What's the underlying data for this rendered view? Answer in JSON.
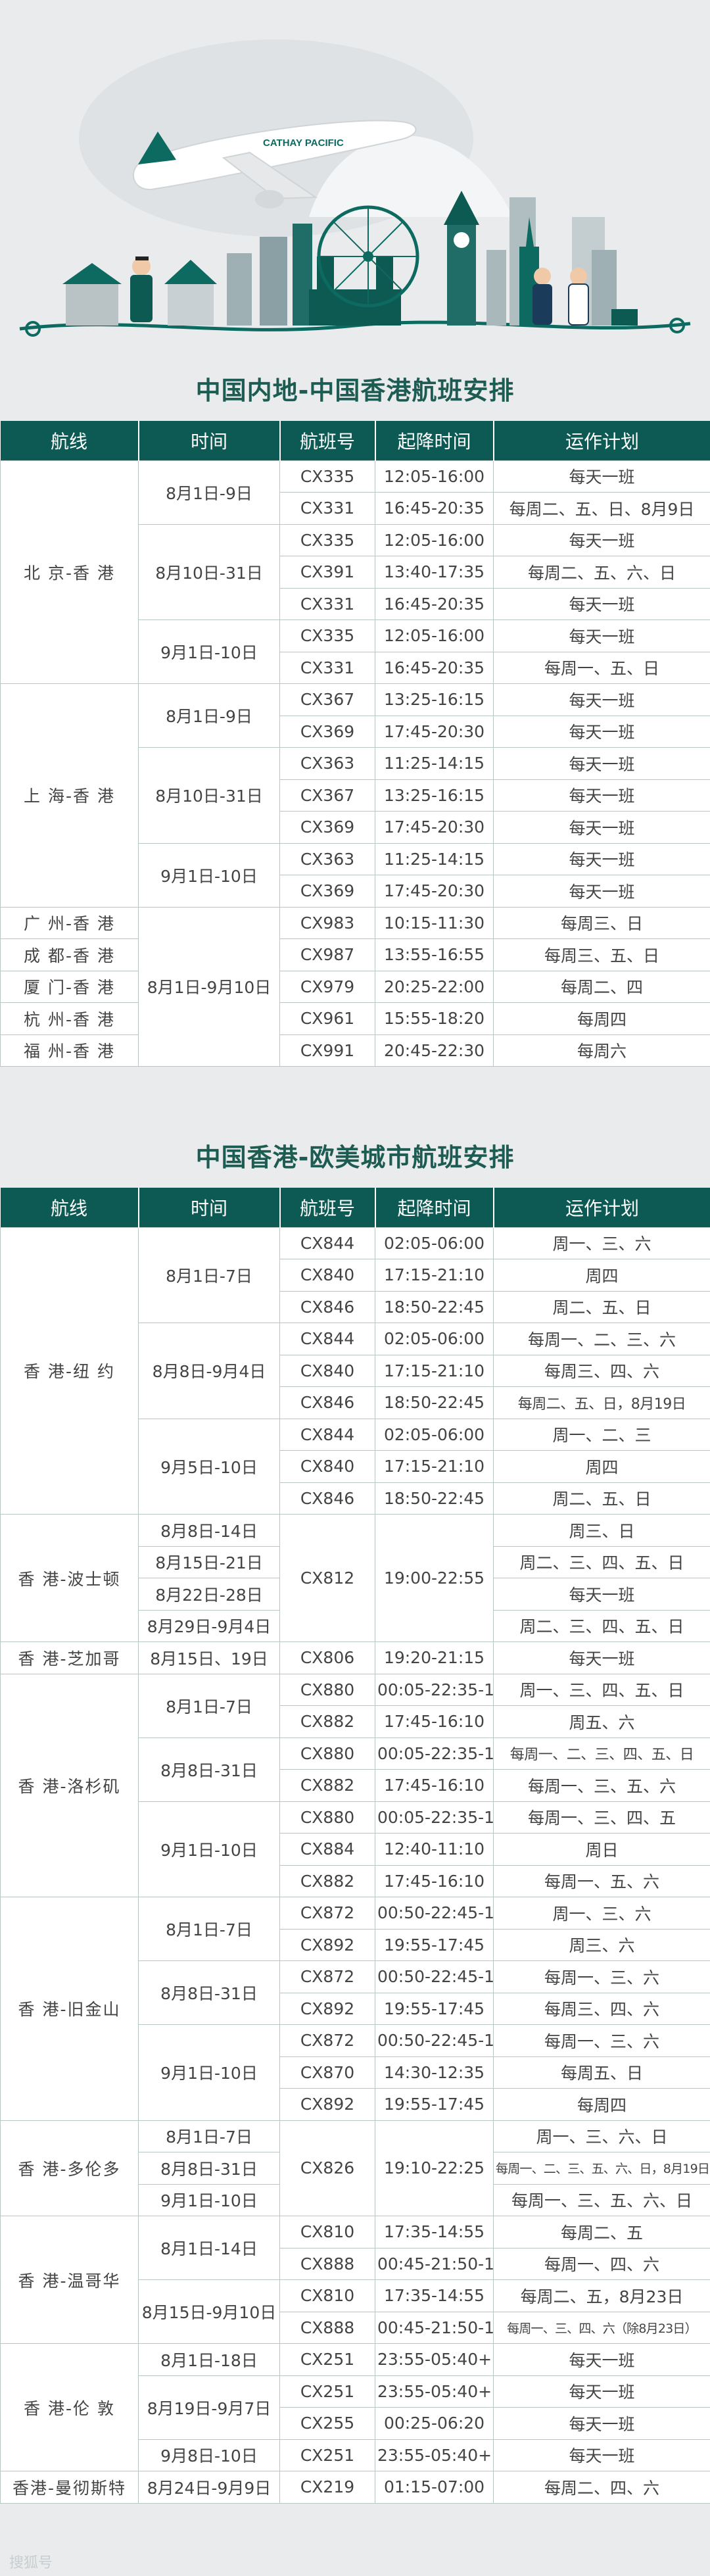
{
  "watermark": "搜狐号",
  "brand_text": "CATHAY PACIFIC",
  "colors": {
    "header_bg": "#0c5a53",
    "title": "#1d5c52",
    "border": "#b9c6c3",
    "page_bg": "#e9ebec"
  },
  "headers": [
    "航线",
    "时间",
    "航班号",
    "起降时间",
    "运作计划"
  ],
  "sections": [
    {
      "title": "中国内地-中国香港航班安排",
      "routes": [
        {
          "name": "北 京-香 港",
          "periods": [
            {
              "date": "8月1日-9日",
              "flights": [
                {
                  "no": "CX335",
                  "time": "12:05-16:00",
                  "plan": "每天一班"
                },
                {
                  "no": "CX331",
                  "time": "16:45-20:35",
                  "plan": "每周二、五、日、8月9日"
                }
              ]
            },
            {
              "date": "8月10日-31日",
              "flights": [
                {
                  "no": "CX335",
                  "time": "12:05-16:00",
                  "plan": "每天一班"
                },
                {
                  "no": "CX391",
                  "time": "13:40-17:35",
                  "plan": "每周二、五、六、日"
                },
                {
                  "no": "CX331",
                  "time": "16:45-20:35",
                  "plan": "每天一班"
                }
              ]
            },
            {
              "date": "9月1日-10日",
              "flights": [
                {
                  "no": "CX335",
                  "time": "12:05-16:00",
                  "plan": "每天一班"
                },
                {
                  "no": "CX331",
                  "time": "16:45-20:35",
                  "plan": "每周一、五、日"
                }
              ]
            }
          ]
        },
        {
          "name": "上 海-香 港",
          "periods": [
            {
              "date": "8月1日-9日",
              "flights": [
                {
                  "no": "CX367",
                  "time": "13:25-16:15",
                  "plan": "每天一班"
                },
                {
                  "no": "CX369",
                  "time": "17:45-20:30",
                  "plan": "每天一班"
                }
              ]
            },
            {
              "date": "8月10日-31日",
              "flights": [
                {
                  "no": "CX363",
                  "time": "11:25-14:15",
                  "plan": "每天一班"
                },
                {
                  "no": "CX367",
                  "time": "13:25-16:15",
                  "plan": "每天一班"
                },
                {
                  "no": "CX369",
                  "time": "17:45-20:30",
                  "plan": "每天一班"
                }
              ]
            },
            {
              "date": "9月1日-10日",
              "flights": [
                {
                  "no": "CX363",
                  "time": "11:25-14:15",
                  "plan": "每天一班"
                },
                {
                  "no": "CX369",
                  "time": "17:45-20:30",
                  "plan": "每天一班"
                }
              ]
            }
          ]
        }
      ],
      "shared_block": {
        "date": "8月1日-9月10日",
        "rows": [
          {
            "route": "广 州-香 港",
            "no": "CX983",
            "time": "10:15-11:30",
            "plan": "每周三、日"
          },
          {
            "route": "成 都-香 港",
            "no": "CX987",
            "time": "13:55-16:55",
            "plan": "每周三、五、日"
          },
          {
            "route": "厦 门-香 港",
            "no": "CX979",
            "time": "20:25-22:00",
            "plan": "每周二、四"
          },
          {
            "route": "杭 州-香 港",
            "no": "CX961",
            "time": "15:55-18:20",
            "plan": "每周四"
          },
          {
            "route": "福 州-香 港",
            "no": "CX991",
            "time": "20:45-22:30",
            "plan": "每周六"
          }
        ]
      }
    },
    {
      "title": "中国香港-欧美城市航班安排",
      "routes": [
        {
          "name": "香 港-纽 约",
          "periods": [
            {
              "date": "8月1日-7日",
              "flights": [
                {
                  "no": "CX844",
                  "time": "02:05-06:00",
                  "plan": "周一、三、六"
                },
                {
                  "no": "CX840",
                  "time": "17:15-21:10",
                  "plan": "周四"
                },
                {
                  "no": "CX846",
                  "time": "18:50-22:45",
                  "plan": "周二、五、日"
                }
              ]
            },
            {
              "date": "8月8日-9月4日",
              "flights": [
                {
                  "no": "CX844",
                  "time": "02:05-06:00",
                  "plan": "每周一、二、三、六"
                },
                {
                  "no": "CX840",
                  "time": "17:15-21:10",
                  "plan": "每周三、四、六"
                },
                {
                  "no": "CX846",
                  "time": "18:50-22:45",
                  "plan": "每周二、五、日，8月19日"
                }
              ]
            },
            {
              "date": "9月5日-10日",
              "flights": [
                {
                  "no": "CX844",
                  "time": "02:05-06:00",
                  "plan": "周一、二、三"
                },
                {
                  "no": "CX840",
                  "time": "17:15-21:10",
                  "plan": "周四"
                },
                {
                  "no": "CX846",
                  "time": "18:50-22:45",
                  "plan": "周二、五、日"
                }
              ]
            }
          ]
        },
        {
          "name": "香 港-波士顿",
          "merged_flight": {
            "no": "CX812",
            "time": "19:00-22:55"
          },
          "periods": [
            {
              "date": "8月8日-14日",
              "plan": "周三、日"
            },
            {
              "date": "8月15日-21日",
              "plan": "周二、三、四、五、日"
            },
            {
              "date": "8月22日-28日",
              "plan": "每天一班"
            },
            {
              "date": "8月29日-9月4日",
              "plan": "周二、三、四、五、日"
            }
          ]
        },
        {
          "name": "香 港-芝加哥",
          "periods": [
            {
              "date": "8月15日、19日",
              "flights": [
                {
                  "no": "CX806",
                  "time": "19:20-21:15",
                  "plan": "每天一班"
                }
              ]
            }
          ]
        },
        {
          "name": "香 港-洛杉矶",
          "periods": [
            {
              "date": "8月1日-7日",
              "flights": [
                {
                  "no": "CX880",
                  "time": "00:05-22:35-1",
                  "plan": "周一、三、四、五、日"
                },
                {
                  "no": "CX882",
                  "time": "17:45-16:10",
                  "plan": "周五、六"
                }
              ]
            },
            {
              "date": "8月8日-31日",
              "flights": [
                {
                  "no": "CX880",
                  "time": "00:05-22:35-1",
                  "plan": "每周一、二、三、四、五、日"
                },
                {
                  "no": "CX882",
                  "time": "17:45-16:10",
                  "plan": "每周一、三、五、六"
                }
              ]
            },
            {
              "date": "9月1日-10日",
              "flights": [
                {
                  "no": "CX880",
                  "time": "00:05-22:35-1",
                  "plan": "每周一、三、四、五"
                },
                {
                  "no": "CX884",
                  "time": "12:40-11:10",
                  "plan": "周日"
                },
                {
                  "no": "CX882",
                  "time": "17:45-16:10",
                  "plan": "每周一、五、六"
                }
              ]
            }
          ]
        },
        {
          "name": "香 港-旧金山",
          "periods": [
            {
              "date": "8月1日-7日",
              "flights": [
                {
                  "no": "CX872",
                  "time": "00:50-22:45-1",
                  "plan": "周一、三、六"
                },
                {
                  "no": "CX892",
                  "time": "19:55-17:45",
                  "plan": "周三、六"
                }
              ]
            },
            {
              "date": "8月8日-31日",
              "flights": [
                {
                  "no": "CX872",
                  "time": "00:50-22:45-1",
                  "plan": "每周一、三、六"
                },
                {
                  "no": "CX892",
                  "time": "19:55-17:45",
                  "plan": "每周三、四、六"
                }
              ]
            },
            {
              "date": "9月1日-10日",
              "flights": [
                {
                  "no": "CX872",
                  "time": "00:50-22:45-1",
                  "plan": "每周一、三、六"
                },
                {
                  "no": "CX870",
                  "time": "14:30-12:35",
                  "plan": "每周五、日"
                },
                {
                  "no": "CX892",
                  "time": "19:55-17:45",
                  "plan": "每周四"
                }
              ]
            }
          ]
        },
        {
          "name": "香 港-多伦多",
          "merged_flight": {
            "no": "CX826",
            "time": "19:10-22:25"
          },
          "periods": [
            {
              "date": "8月1日-7日",
              "plan": "周一、三、六、日"
            },
            {
              "date": "8月8日-31日",
              "plan": "每周一、二、三、五、六、日，8月19日"
            },
            {
              "date": "9月1日-10日",
              "plan": "每周一、三、五、六、日"
            }
          ]
        },
        {
          "name": "香 港-温哥华",
          "periods": [
            {
              "date": "8月1日-14日",
              "flights": [
                {
                  "no": "CX810",
                  "time": "17:35-14:55",
                  "plan": "每周二、五"
                },
                {
                  "no": "CX888",
                  "time": "00:45-21:50-1",
                  "plan": "每周一、四、六"
                }
              ]
            },
            {
              "date": "8月15日-9月10日",
              "flights": [
                {
                  "no": "CX810",
                  "time": "17:35-14:55",
                  "plan": "每周二、五，8月23日"
                },
                {
                  "no": "CX888",
                  "time": "00:45-21:50-1",
                  "plan": "每周一、三、四、六（除8月23日）"
                }
              ]
            }
          ]
        },
        {
          "name": "香 港-伦 敦",
          "periods": [
            {
              "date": "8月1日-18日",
              "flights": [
                {
                  "no": "CX251",
                  "time": "23:55-05:40+1",
                  "plan": "每天一班"
                }
              ]
            },
            {
              "date": "8月19日-9月7日",
              "flights": [
                {
                  "no": "CX251",
                  "time": "23:55-05:40+1",
                  "plan": "每天一班"
                },
                {
                  "no": "CX255",
                  "time": "00:25-06:20",
                  "plan": "每天一班"
                }
              ]
            },
            {
              "date": "9月8日-10日",
              "flights": [
                {
                  "no": "CX251",
                  "time": "23:55-05:40+1",
                  "plan": "每天一班"
                }
              ]
            }
          ]
        },
        {
          "name": "香港-曼彻斯特",
          "periods": [
            {
              "date": "8月24日-9月9日",
              "flights": [
                {
                  "no": "CX219",
                  "time": "01:15-07:00",
                  "plan": "每周二、四、六"
                }
              ]
            }
          ]
        }
      ]
    }
  ]
}
